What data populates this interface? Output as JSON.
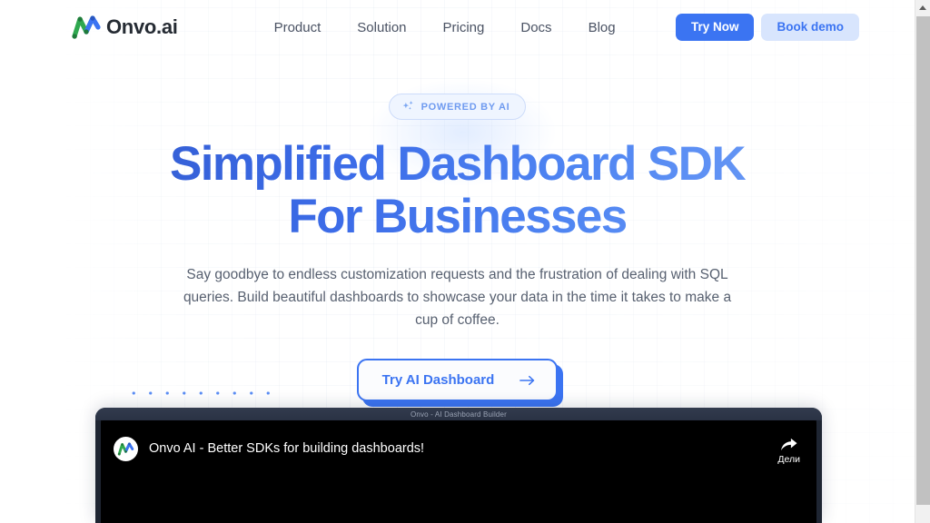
{
  "brand": {
    "name": "Onvo.ai",
    "logo_icon": "onvo-zigzag-logo",
    "logo_green": "#2fa84f",
    "logo_blue": "#3b74f2"
  },
  "nav": {
    "items": [
      {
        "label": "Product"
      },
      {
        "label": "Solution"
      },
      {
        "label": "Pricing"
      },
      {
        "label": "Docs"
      },
      {
        "label": "Blog"
      }
    ]
  },
  "header_actions": {
    "try_now_label": "Try Now",
    "book_demo_label": "Book demo",
    "primary_color": "#3b74f2",
    "secondary_bg": "#d8e5fd"
  },
  "hero": {
    "badge": {
      "icon": "sparkles-icon",
      "label": "POWERED BY AI"
    },
    "title_line_1": "Simplified Dashboard SDK",
    "title_line_2": "For Businesses",
    "subtitle": "Say goodbye to endless customization requests and the frustration of dealing with SQL queries. Build beautiful dashboards to showcase your data in the time it takes to make a cup of coffee.",
    "cta_label": "Try AI Dashboard",
    "cta_icon": "arrow-right-icon",
    "title_gradient_start": "#3056c8",
    "title_gradient_end": "#79a5f7"
  },
  "decoration": {
    "dot_grid_color": "#5b8ef5"
  },
  "video": {
    "window_title": "Onvo - AI Dashboard Builder",
    "title": "Onvo AI - Better SDKs for building dashboards!",
    "channel_avatar_icon": "onvo-zigzag-logo",
    "share_icon": "share-arrow-icon",
    "share_label": "Дели"
  },
  "scrollbar": {
    "up_arrow_icon": "caret-up-icon"
  }
}
